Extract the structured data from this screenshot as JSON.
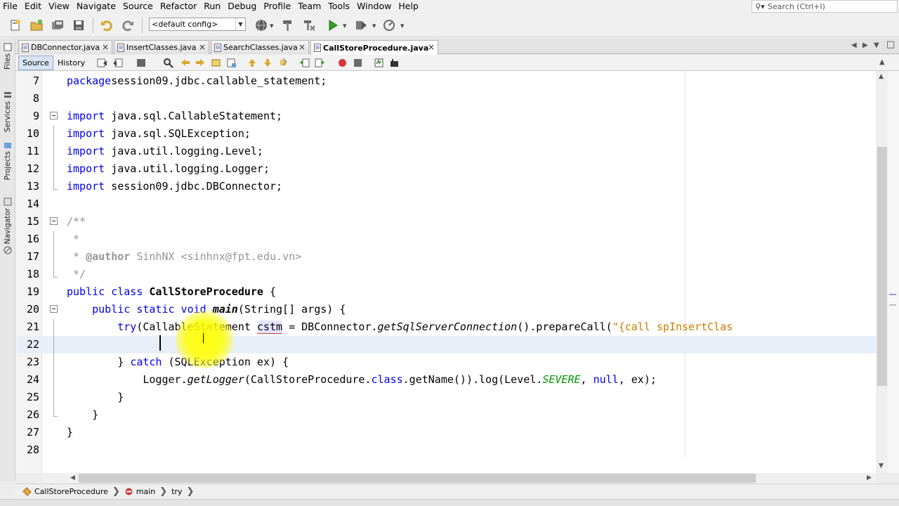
{
  "menu": [
    "File",
    "Edit",
    "View",
    "Navigate",
    "Source",
    "Refactor",
    "Run",
    "Debug",
    "Profile",
    "Team",
    "Tools",
    "Window",
    "Help"
  ],
  "search": {
    "placeholder": "Search (Ctrl+I)"
  },
  "toolbar": {
    "config": "<default config>"
  },
  "sidebar": {
    "files": "Files",
    "services": "Services",
    "projects": "Projects",
    "navigator": "Navigator"
  },
  "tabs": [
    {
      "label": "DBConnector.java",
      "active": false
    },
    {
      "label": "InsertClasses.java",
      "active": false
    },
    {
      "label": "SearchClasses.java",
      "active": false
    },
    {
      "label": "CallStoreProcedure.java",
      "active": true
    }
  ],
  "editor_toolbar": {
    "source": "Source",
    "history": "History"
  },
  "code": {
    "lines": [
      {
        "n": "7",
        "segs": [
          [
            "kw",
            "package"
          ],
          [
            "",
            "session09.jdbc.callable_statement;"
          ]
        ]
      },
      {
        "n": "8",
        "segs": []
      },
      {
        "n": "9",
        "segs": [
          [
            "kw",
            "import"
          ],
          [
            "",
            " java.sql.CallableStatement;"
          ]
        ]
      },
      {
        "n": "10",
        "segs": [
          [
            "kw",
            "import"
          ],
          [
            "",
            " java.sql.SQLException;"
          ]
        ]
      },
      {
        "n": "11",
        "segs": [
          [
            "kw",
            "import"
          ],
          [
            "",
            " java.util.logging.Level;"
          ]
        ]
      },
      {
        "n": "12",
        "segs": [
          [
            "kw",
            "import"
          ],
          [
            "",
            " java.util.logging.Logger;"
          ]
        ]
      },
      {
        "n": "13",
        "segs": [
          [
            "kw",
            "import"
          ],
          [
            "",
            " session09.jdbc.DBConnector;"
          ]
        ]
      },
      {
        "n": "14",
        "segs": []
      },
      {
        "n": "15",
        "segs": [
          [
            "cm",
            "/**"
          ]
        ]
      },
      {
        "n": "16",
        "segs": [
          [
            "cm",
            " *"
          ]
        ]
      },
      {
        "n": "17",
        "segs": [
          [
            "cm",
            " * "
          ],
          [
            "cmb",
            "@author"
          ],
          [
            "cm",
            " SinhNX "
          ],
          [
            "tag",
            "<sinhnx@fpt.edu.vn>"
          ]
        ]
      },
      {
        "n": "18",
        "segs": [
          [
            "cm",
            " */"
          ]
        ]
      },
      {
        "n": "19",
        "segs": [
          [
            "kw",
            "public class "
          ],
          [
            "cls",
            "CallStoreProcedure"
          ],
          [
            "",
            " {"
          ]
        ]
      },
      {
        "n": "20",
        "segs": [
          [
            "",
            "    "
          ],
          [
            "kw",
            "public static void "
          ],
          [
            "mtd",
            "main"
          ],
          [
            "",
            "(String[] args) {"
          ]
        ]
      },
      {
        "n": "21",
        "segs": [
          [
            "",
            "        "
          ],
          [
            "kw",
            "try"
          ],
          [
            "",
            "(CallableStatement "
          ],
          [
            "var",
            "cstm"
          ],
          [
            "",
            " = DBConnector."
          ],
          [
            "ital",
            "getSqlServerConnection"
          ],
          [
            "",
            "().prepareCall("
          ],
          [
            "str",
            "\"{call spInsertClas"
          ]
        ]
      },
      {
        "n": "22",
        "segs": []
      },
      {
        "n": "23",
        "segs": [
          [
            "",
            "        } "
          ],
          [
            "kw",
            "catch"
          ],
          [
            "",
            " (SQLException ex) {"
          ]
        ]
      },
      {
        "n": "24",
        "segs": [
          [
            "",
            "            Logger."
          ],
          [
            "ital",
            "getLogger"
          ],
          [
            "",
            "(CallStoreProcedure."
          ],
          [
            "kw",
            "class"
          ],
          [
            "",
            ".getName()).log(Level."
          ],
          [
            "fld",
            "SEVERE"
          ],
          [
            "",
            ", "
          ],
          [
            "kw",
            "null"
          ],
          [
            "",
            ", ex);"
          ]
        ]
      },
      {
        "n": "25",
        "segs": [
          [
            "",
            "        }"
          ]
        ]
      },
      {
        "n": "26",
        "segs": [
          [
            "",
            "    }"
          ]
        ]
      },
      {
        "n": "27",
        "segs": [
          [
            "",
            "}"
          ]
        ]
      },
      {
        "n": "28",
        "segs": []
      }
    ]
  },
  "breadcrumb": [
    "CallStoreProcedure",
    "main",
    "try"
  ]
}
